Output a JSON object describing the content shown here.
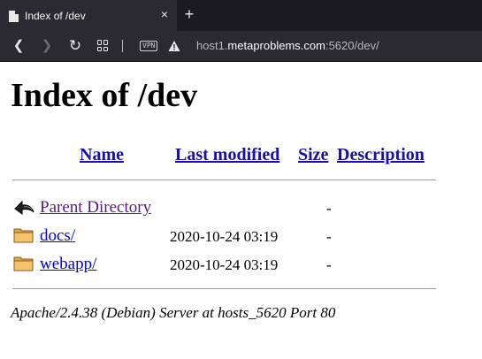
{
  "browser": {
    "tab_title": "Index of /dev",
    "close_glyph": "×",
    "new_tab_glyph": "+",
    "back_glyph": "❮",
    "forward_glyph": "❯",
    "reload_glyph": "↻",
    "vpn_label": "VPN",
    "url_prefix": "host1.",
    "url_domain": "metaproblems.com",
    "url_suffix": ":5620/dev/",
    "icons": [
      "page-icon",
      "close-icon",
      "plus-icon",
      "back-icon",
      "forward-icon",
      "reload-icon",
      "tabs-grid-icon",
      "vpn-icon",
      "warning-icon"
    ]
  },
  "page": {
    "heading": "Index of /dev",
    "columns": {
      "name": "Name",
      "last_modified": "Last modified",
      "size": "Size",
      "description": "Description"
    },
    "rows": [
      {
        "icon": "back-arrow-icon",
        "name": "Parent Directory",
        "date": "",
        "size": "-"
      },
      {
        "icon": "folder-icon",
        "name": "docs/",
        "date": "2020-10-24 03:19",
        "size": "-"
      },
      {
        "icon": "folder-icon",
        "name": "webapp/",
        "date": "2020-10-24 03:19",
        "size": "-"
      }
    ],
    "address": "Apache/2.4.38 (Debian) Server at hosts_5620 Port 80"
  },
  "colors": {
    "tab_bg": "#2b2a33",
    "tabbar_bg": "#1c1b22",
    "link": "#0000ee",
    "visited": "#551a8b",
    "header_link": "#1a0dab"
  }
}
